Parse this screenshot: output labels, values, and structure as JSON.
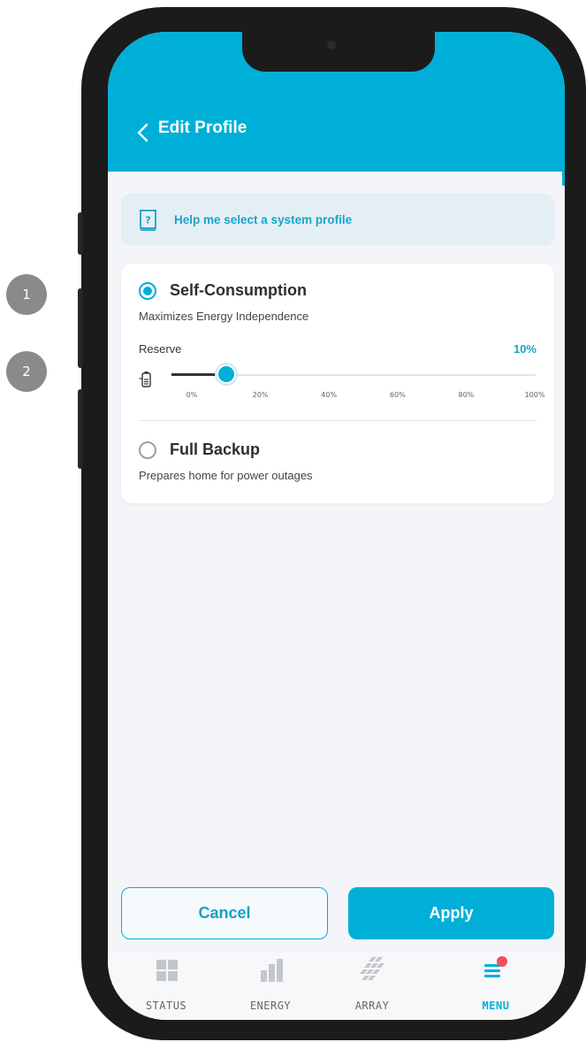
{
  "steps": [
    "1",
    "2"
  ],
  "header": {
    "title": "Edit Profile"
  },
  "help": {
    "text": "Help me select a system profile"
  },
  "profiles": [
    {
      "title": "Self-Consumption",
      "subtitle": "Maximizes Energy Independence",
      "selected": true
    },
    {
      "title": "Full Backup",
      "subtitle": "Prepares home for power outages",
      "selected": false
    }
  ],
  "reserve": {
    "label": "Reserve",
    "value_text": "10%",
    "value_percent": 10,
    "ticks": [
      "0%",
      "20%",
      "40%",
      "60%",
      "80%",
      "100%"
    ]
  },
  "buttons": {
    "cancel": "Cancel",
    "apply": "Apply"
  },
  "tabs": [
    {
      "label": "STATUS",
      "icon": "grid-icon"
    },
    {
      "label": "ENERGY",
      "icon": "bar-chart-icon"
    },
    {
      "label": "ARRAY",
      "icon": "solar-panel-icon"
    },
    {
      "label": "MENU",
      "icon": "menu-icon",
      "active": true
    }
  ],
  "colors": {
    "accent": "#00afd8",
    "notification": "#f0505a"
  }
}
